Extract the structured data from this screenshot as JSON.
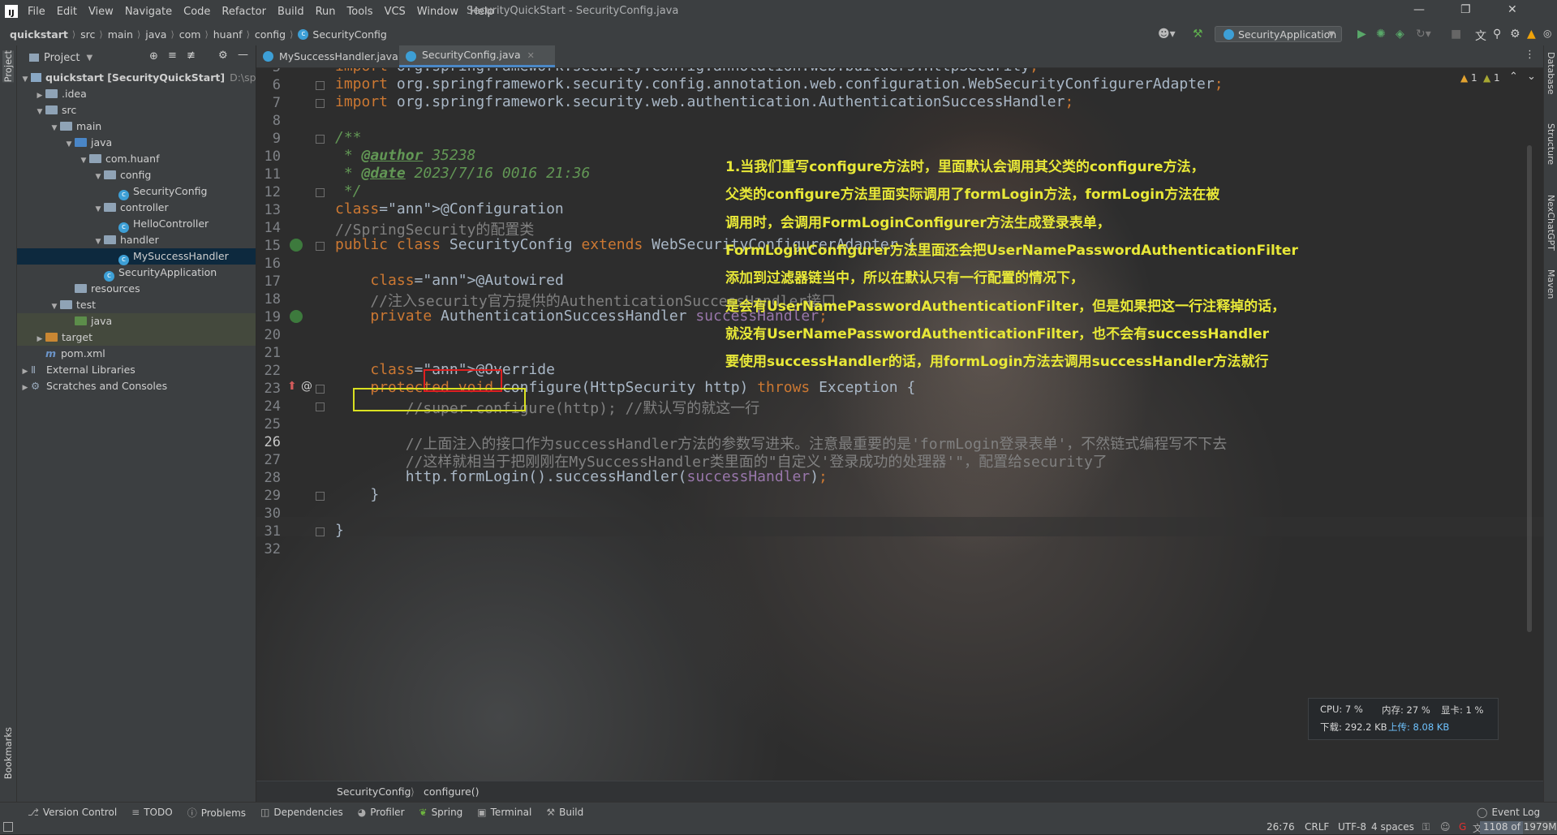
{
  "window": {
    "title": "SecurityQuickStart - SecurityConfig.java",
    "menu": [
      "File",
      "Edit",
      "View",
      "Navigate",
      "Code",
      "Refactor",
      "Build",
      "Run",
      "Tools",
      "VCS",
      "Window",
      "Help"
    ]
  },
  "nav": {
    "breadcrumb": [
      "quickstart",
      "src",
      "main",
      "java",
      "com",
      "huanf",
      "config",
      "SecurityConfig"
    ],
    "run_config": "SecurityApplication"
  },
  "project": {
    "title": "Project",
    "tree": [
      {
        "label": "quickstart [SecurityQuickStart]",
        "path": "D:\\springs",
        "depth": 0,
        "arrow": "down",
        "icon": "module"
      },
      {
        "label": ".idea",
        "depth": 1,
        "arrow": "right",
        "icon": "folder"
      },
      {
        "label": "src",
        "depth": 1,
        "arrow": "down",
        "icon": "folder"
      },
      {
        "label": "main",
        "depth": 2,
        "arrow": "down",
        "icon": "folder"
      },
      {
        "label": "java",
        "depth": 3,
        "arrow": "down",
        "icon": "src"
      },
      {
        "label": "com.huanf",
        "depth": 4,
        "arrow": "down",
        "icon": "folder"
      },
      {
        "label": "config",
        "depth": 5,
        "arrow": "down",
        "icon": "folder"
      },
      {
        "label": "SecurityConfig",
        "depth": 6,
        "arrow": "",
        "icon": "class"
      },
      {
        "label": "controller",
        "depth": 5,
        "arrow": "down",
        "icon": "folder"
      },
      {
        "label": "HelloController",
        "depth": 6,
        "arrow": "",
        "icon": "class"
      },
      {
        "label": "handler",
        "depth": 5,
        "arrow": "down",
        "icon": "folder"
      },
      {
        "label": "MySuccessHandler",
        "depth": 6,
        "arrow": "",
        "icon": "class",
        "selected": true
      },
      {
        "label": "SecurityApplication",
        "depth": 5,
        "arrow": "",
        "icon": "class"
      },
      {
        "label": "resources",
        "depth": 3,
        "arrow": "",
        "icon": "folder"
      },
      {
        "label": "test",
        "depth": 2,
        "arrow": "down",
        "icon": "folder"
      },
      {
        "label": "java",
        "depth": 3,
        "arrow": "",
        "icon": "green",
        "highlight": true
      },
      {
        "label": "target",
        "depth": 1,
        "arrow": "right",
        "icon": "orange",
        "highlight": true
      },
      {
        "label": "pom.xml",
        "depth": 1,
        "arrow": "",
        "icon": "maven"
      },
      {
        "label": "External Libraries",
        "depth": 0,
        "arrow": "right",
        "icon": "lib"
      },
      {
        "label": "Scratches and Consoles",
        "depth": 0,
        "arrow": "right",
        "icon": "scratch"
      }
    ]
  },
  "tabs": [
    {
      "label": "MySuccessHandler.java",
      "active": false
    },
    {
      "label": "SecurityConfig.java",
      "active": true
    }
  ],
  "editor": {
    "inspections": {
      "warnings": "1",
      "weak": "1"
    },
    "lines": [
      {
        "n": "5",
        "code": "import org.springframework.security.config.annotation.web.builders.HttpSecurity;"
      },
      {
        "n": "6",
        "code": "import org.springframework.security.config.annotation.web.configuration.WebSecurityConfigurerAdapter;"
      },
      {
        "n": "7",
        "code": "import org.springframework.security.web.authentication.AuthenticationSuccessHandler;"
      },
      {
        "n": "8",
        "code": ""
      },
      {
        "n": "9",
        "code": "/**"
      },
      {
        "n": "10",
        "code": " * @author 35238"
      },
      {
        "n": "11",
        "code": " * @date 2023/7/16 0016 21:36"
      },
      {
        "n": "12",
        "code": " */"
      },
      {
        "n": "13",
        "code": "@Configuration"
      },
      {
        "n": "14",
        "code": "//SpringSecurity的配置类"
      },
      {
        "n": "15",
        "code": "public class SecurityConfig extends WebSecurityConfigurerAdapter {"
      },
      {
        "n": "16",
        "code": ""
      },
      {
        "n": "17",
        "code": "    @Autowired"
      },
      {
        "n": "18",
        "code": "    //注入security官方提供的AuthenticationSuccessHandler接口"
      },
      {
        "n": "19",
        "code": "    private AuthenticationSuccessHandler successHandler;"
      },
      {
        "n": "20",
        "code": ""
      },
      {
        "n": "21",
        "code": ""
      },
      {
        "n": "22",
        "code": "    @Override"
      },
      {
        "n": "23",
        "code": "    protected void configure(HttpSecurity http) throws Exception {"
      },
      {
        "n": "24",
        "code": "        //super.configure(http); //默认写的就这一行"
      },
      {
        "n": "25",
        "code": ""
      },
      {
        "n": "26",
        "code": "        //上面注入的接口作为successHandler方法的参数写进来。注意最重要的是'formLogin登录表单'，不然链式编程写不下去"
      },
      {
        "n": "27",
        "code": "        //这样就相当于把刚刚在MySuccessHandler类里面的\"自定义'登录成功的处理器'\"，配置给security了"
      },
      {
        "n": "28",
        "code": "        http.formLogin().successHandler(successHandler);"
      },
      {
        "n": "29",
        "code": "    }"
      },
      {
        "n": "30",
        "code": ""
      },
      {
        "n": "31",
        "code": "}"
      },
      {
        "n": "32",
        "code": ""
      }
    ],
    "current_line": "26",
    "notes": [
      "1.当我们重写configure方法时，里面默认会调用其父类的configure方法，",
      "父类的configure方法里面实际调用了formLogin方法，formLogin方法在被",
      "调用时，会调用FormLoginConfigurer方法生成登录表单，",
      "FormLoginConfigurer方法里面还会把UserNamePasswordAuthenticationFilter",
      "添加到过滤器链当中，所以在默认只有一行配置的情况下，",
      "是会有UserNamePasswordAuthenticationFilter，但是如果把这一行注释掉的话，",
      "就没有UserNamePasswordAuthenticationFilter，也不会有successHandler",
      "要使用successHandler的话，用formLogin方法去调用successHandler方法就行"
    ]
  },
  "perf": {
    "cpu": "CPU: 7 %",
    "mem": "内存: 27 %",
    "gpu": "显卡: 1 %",
    "down": "下载: 292.2 KB",
    "up": "上传: 8.08 KB"
  },
  "breadcrumb_bottom": [
    "SecurityConfig",
    "configure()"
  ],
  "right_tabs": [
    "Database",
    "Structure",
    "NexChatGPT",
    "Maven"
  ],
  "left_tabs": {
    "project": "Project",
    "bookmarks": "Bookmarks"
  },
  "toolwindows": [
    "Version Control",
    "TODO",
    "Problems",
    "Dependencies",
    "Profiler",
    "Spring",
    "Terminal",
    "Build"
  ],
  "event_log": "Event Log",
  "status": {
    "position": "26:76",
    "line_sep": "CRLF",
    "encoding": "UTF-8",
    "indent": "4 spaces",
    "memory": "1108 of 1979M"
  },
  "colors": {
    "accent": "#4a88c7",
    "note": "#e8e838",
    "red_box": "#e02020",
    "yellow_box": "#d9e021"
  }
}
